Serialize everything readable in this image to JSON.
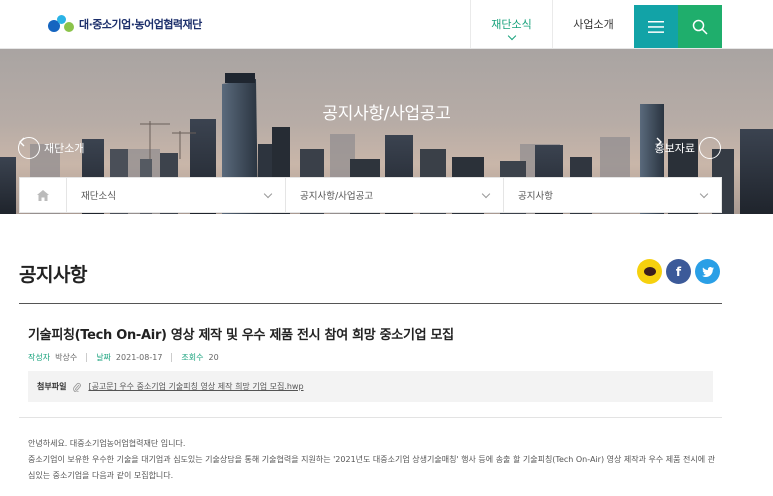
{
  "header": {
    "logo_text": "대·중소기업·농어업협력재단",
    "nav": [
      {
        "label": "재단소식",
        "active": true
      },
      {
        "label": "사업소개",
        "active": false
      }
    ],
    "menu_icon": "hamburger-icon",
    "search_icon": "search-icon",
    "colors": {
      "accent": "#17a27c",
      "menu_bg": "#12a3a7",
      "search_bg": "#1fae6c"
    }
  },
  "hero": {
    "title": "공지사항/사업공고",
    "prev_label": "재단소개",
    "next_label": "홍보자료"
  },
  "breadcrumb": {
    "home_icon": "home-icon",
    "items": [
      "재단소식",
      "공지사항/사업공고",
      "공지사항"
    ]
  },
  "page": {
    "title": "공지사항",
    "share": {
      "kakao_icon": "kakao-icon",
      "facebook_icon": "facebook-icon",
      "twitter_icon": "twitter-icon"
    }
  },
  "post": {
    "title": "기술피칭(Tech On-Air) 영상 제작 및 우수 제품 전시 참여 희망 중소기업 모집",
    "meta": {
      "author_label": "작성자",
      "author": "박상수",
      "date_label": "날짜",
      "date": "2021-08-17",
      "views_label": "조회수",
      "views": "20"
    },
    "attachment": {
      "label": "첨부파일",
      "icon": "paperclip-icon",
      "file_name": "[공고문] 우수 중소기업 기술피칭 영상 제작 희망 기업 모집.hwp"
    },
    "body": [
      "안녕하세요. 대중소기업농어업협력재단 입니다.",
      "중소기업이 보유한 우수한 기술을 대기업과 심도있는 기술상담을 통해 기술협력을 지원하는 '2021년도 대중소기업 상생기술매칭' 행사 등에 송출 할 기술피칭(Tech On-Air) 영상 제작과 우수 제품 전시에 관심있는 중소기업을 다음과 같이 모집합니다."
    ]
  }
}
